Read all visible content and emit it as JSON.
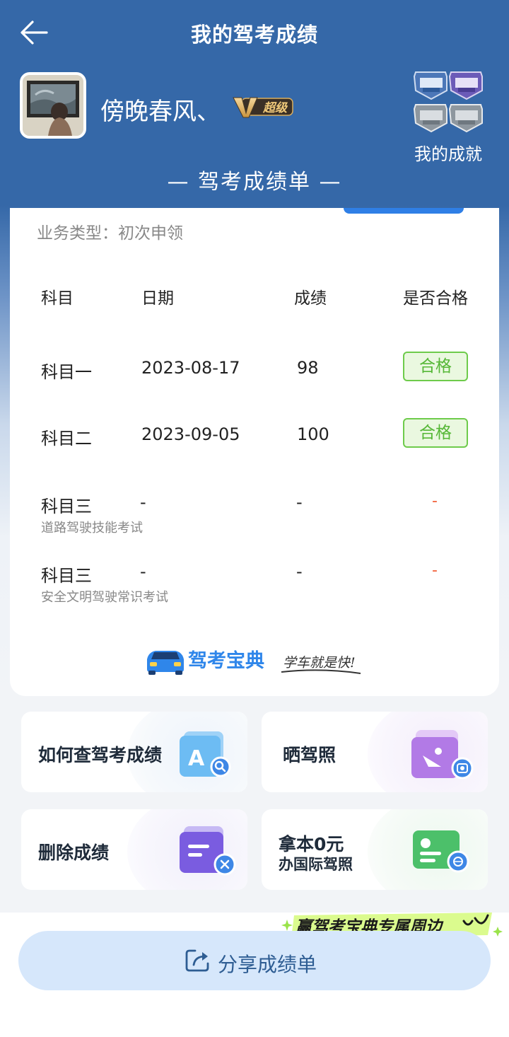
{
  "header": {
    "title": "我的驾考成绩"
  },
  "profile": {
    "username": "傍晚春风、",
    "vip_label": "超级",
    "achievements_label": "我的成就"
  },
  "section_title": "— 驾考成绩单 —",
  "record": {
    "business_type": "业务类型：初次申领",
    "columns": [
      "科目",
      "日期",
      "成绩",
      "是否合格"
    ],
    "rows": [
      {
        "subject": "科目一",
        "subtitle": "",
        "date": "2023-08-17",
        "score": "98",
        "result": "合格"
      },
      {
        "subject": "科目二",
        "subtitle": "",
        "date": "2023-09-05",
        "score": "100",
        "result": "合格"
      },
      {
        "subject": "科目三",
        "subtitle": "道路驾驶技能考试",
        "date": "-",
        "score": "-",
        "result": "-"
      },
      {
        "subject": "科目三",
        "subtitle": "安全文明驾驶常识考试",
        "date": "-",
        "score": "-",
        "result": "-"
      }
    ]
  },
  "brand": {
    "name": "驾考宝典",
    "slogan": "学车就是快!"
  },
  "actions": [
    {
      "label": "如何查驾考成绩",
      "icon": "search-doc-icon"
    },
    {
      "label": "晒驾照",
      "icon": "photo-camera-icon"
    },
    {
      "label": "删除成绩",
      "icon": "delete-doc-icon"
    },
    {
      "label": "拿本0元",
      "label2": "办国际驾照",
      "icon": "id-card-globe-icon"
    }
  ],
  "promo": "赢驾考宝典专属周边",
  "share_button": "分享成绩单",
  "colors": {
    "header_blue": "#3568a8",
    "pass_green": "#55b736",
    "pending_red": "#f2603a",
    "share_bg": "#d6e7fb"
  }
}
